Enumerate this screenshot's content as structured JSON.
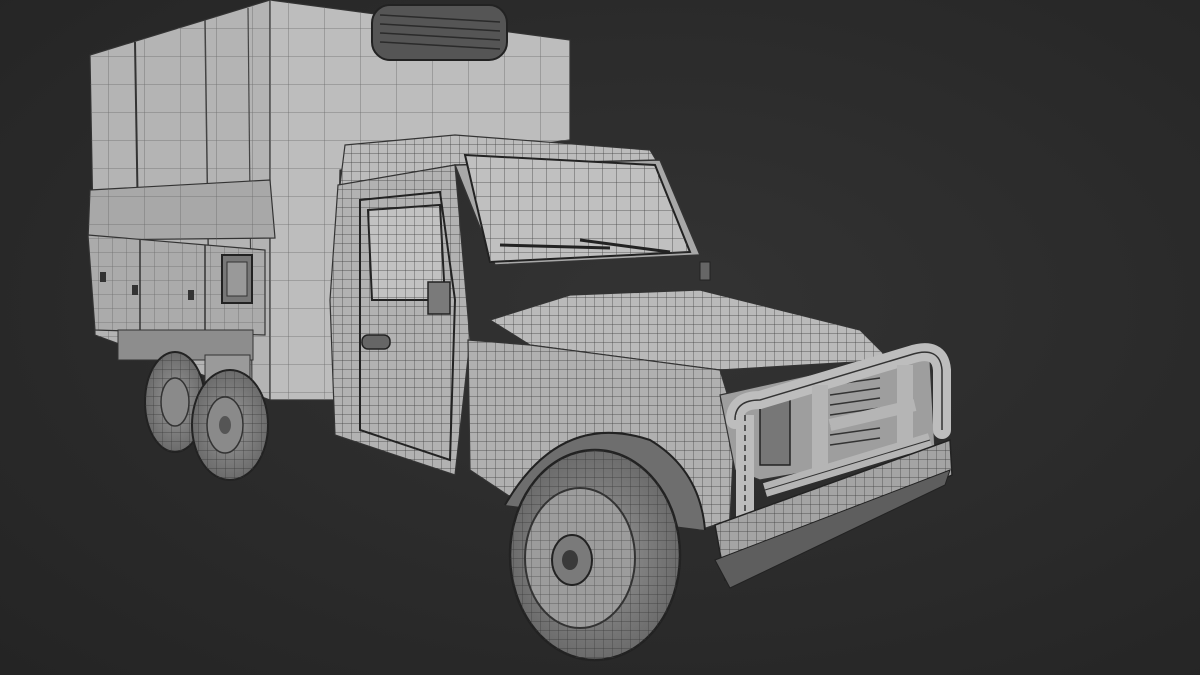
{
  "viewport": {
    "background_color": "#2b2b2b",
    "shading": "wireframe-over-solid",
    "mesh_color": "#a9a9a9",
    "wire_color": "#3a3a3a"
  },
  "model": {
    "subject": "truck-with-box-body",
    "colors": {
      "body": "#b5b5b5",
      "body_dark": "#8f8f8f",
      "tire": "#7d7d7d",
      "shadow": "#5a5a5a",
      "wire": "#2e2e2e"
    }
  }
}
